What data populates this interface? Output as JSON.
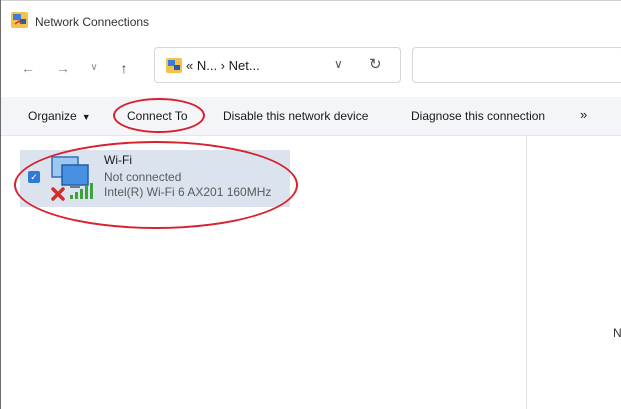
{
  "window": {
    "title": "Network Connections"
  },
  "nav": {
    "back_icon": "arrow-left-icon",
    "forward_icon": "arrow-right-icon",
    "recent_icon": "chevron-down-icon",
    "up_icon": "arrow-up-icon",
    "address": "« N... › Net...",
    "refresh_icon": "refresh-icon"
  },
  "toolbar": {
    "organize": "Organize",
    "connect_to": "Connect To",
    "disable": "Disable this network device",
    "diagnose": "Diagnose this connection",
    "more": "»"
  },
  "items": [
    {
      "name": "Wi-Fi",
      "status": "Not connected",
      "device": "Intel(R) Wi-Fi 6 AX201 160MHz",
      "selected": true
    }
  ],
  "details": {
    "text": "N"
  },
  "colors": {
    "annotation": "#d9202e",
    "selection": "#dbe4ee",
    "checkbox": "#2f7ad6"
  }
}
